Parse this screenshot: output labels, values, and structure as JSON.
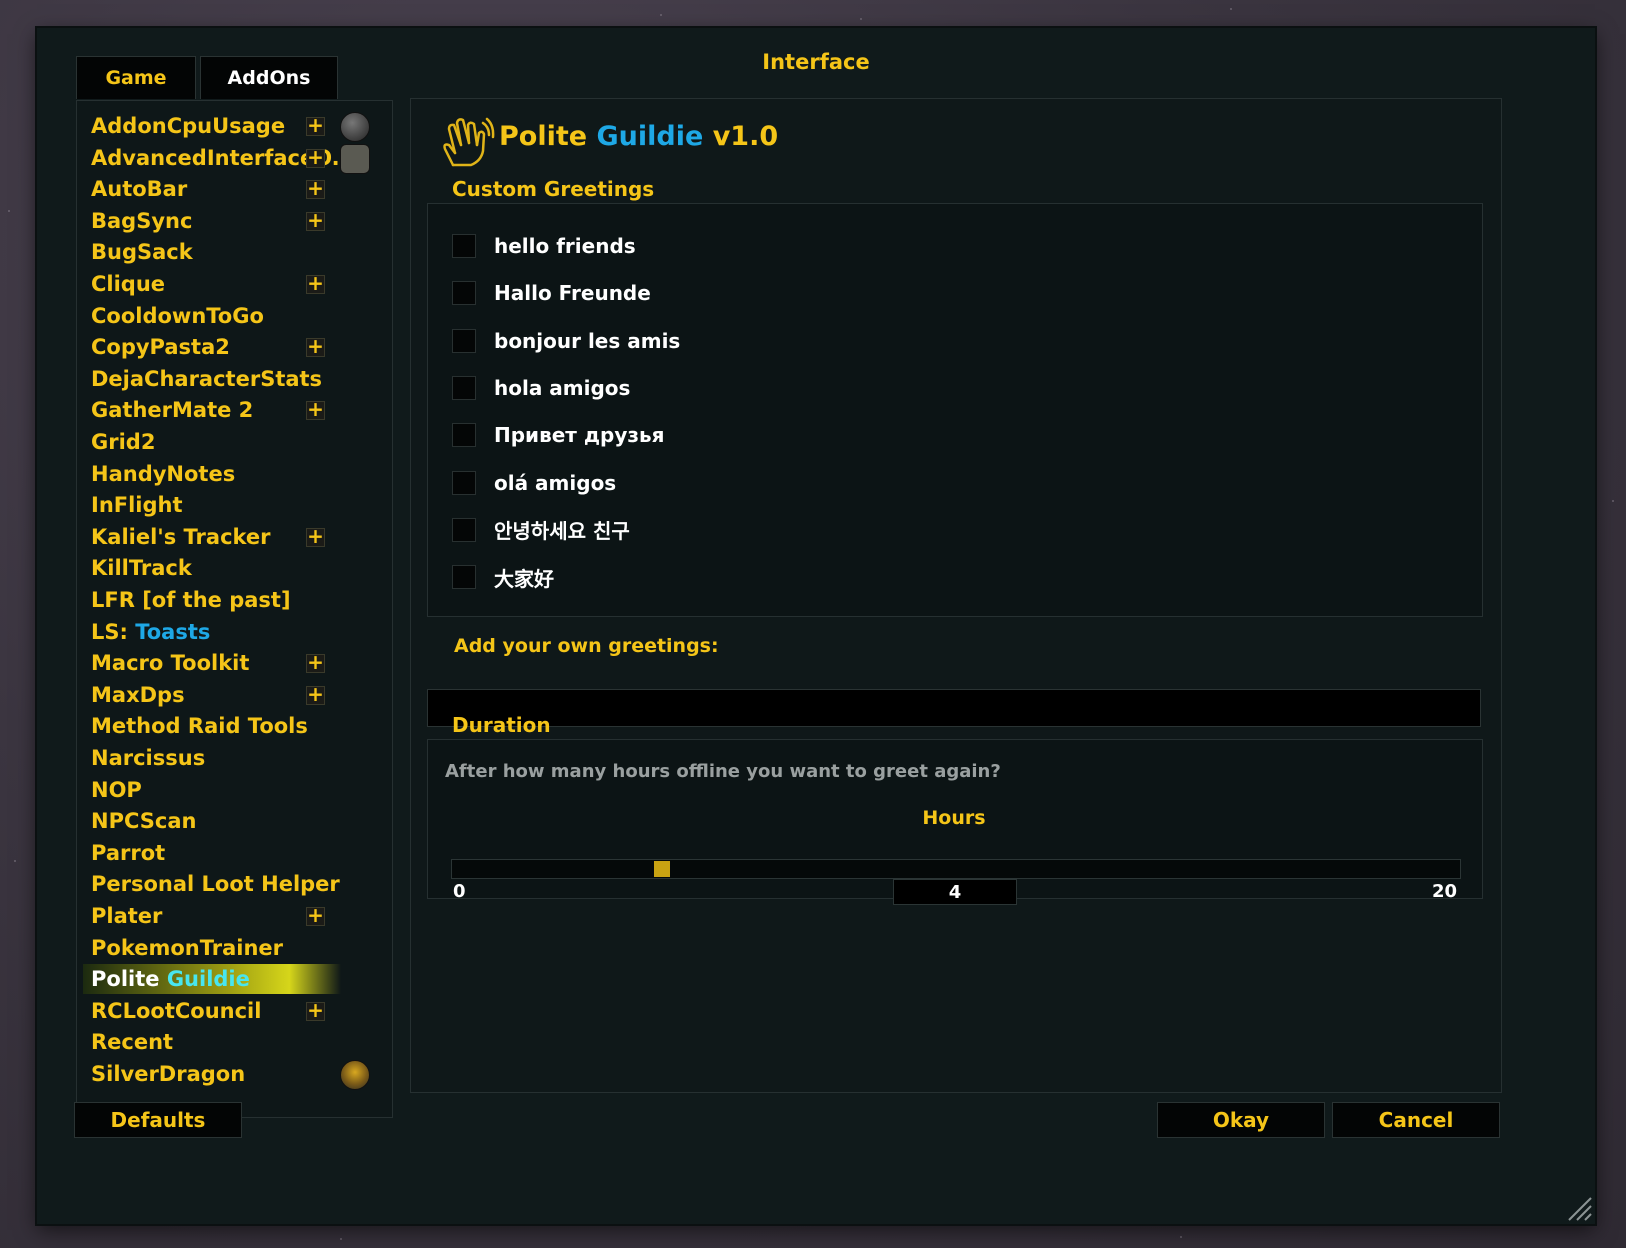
{
  "window": {
    "title": "Interface"
  },
  "tabs": [
    {
      "label": "Game",
      "active": true
    },
    {
      "label": "AddOns",
      "active": false
    }
  ],
  "addons": [
    {
      "name": "AddonCpuUsage",
      "expand": true,
      "icon": "settings-icon"
    },
    {
      "name": "AdvancedInterfaceO...",
      "expand": true,
      "icon": "square-stone-icon"
    },
    {
      "name": "AutoBar",
      "expand": true
    },
    {
      "name": "BagSync",
      "expand": true
    },
    {
      "name": "BugSack"
    },
    {
      "name": "Clique",
      "expand": true
    },
    {
      "name": "CooldownToGo"
    },
    {
      "name": "CopyPasta2",
      "expand": true
    },
    {
      "name": "DejaCharacterStats"
    },
    {
      "name": "GatherMate 2",
      "expand": true
    },
    {
      "name": "Grid2"
    },
    {
      "name": "HandyNotes"
    },
    {
      "name": "InFlight"
    },
    {
      "name": "Kaliel's Tracker",
      "expand": true
    },
    {
      "name": "KillTrack"
    },
    {
      "name": "LFR [of the past]"
    },
    {
      "name": "LS:",
      "name_highlight": "Toasts"
    },
    {
      "name": "Macro Toolkit",
      "expand": true
    },
    {
      "name": "MaxDps",
      "expand": true
    },
    {
      "name": "Method Raid Tools"
    },
    {
      "name": "Narcissus"
    },
    {
      "name": "NOP"
    },
    {
      "name": "NPCScan"
    },
    {
      "name": "Parrot"
    },
    {
      "name": "Personal Loot Helper"
    },
    {
      "name": "Plater",
      "expand": true
    },
    {
      "name": "PokemonTrainer"
    },
    {
      "name": "Polite",
      "name_highlight": "Guildie",
      "selected": true
    },
    {
      "name": "RCLootCouncil",
      "expand": true
    },
    {
      "name": "Recent"
    },
    {
      "name": "SilverDragon",
      "icon": "dragon-emblem-icon"
    }
  ],
  "panel": {
    "title_part1": "Polite",
    "title_part2": "Guildie",
    "title_part3": "v1.0",
    "icon": "waving-hand-icon",
    "custom_greetings_label": "Custom Greetings",
    "greetings": [
      {
        "text": "hello friends",
        "checked": false
      },
      {
        "text": "Hallo Freunde",
        "checked": false
      },
      {
        "text": "bonjour les amis",
        "checked": false
      },
      {
        "text": "hola amigos",
        "checked": false
      },
      {
        "text": "Привет друзья",
        "checked": false
      },
      {
        "text": "olá amigos",
        "checked": false
      },
      {
        "text": "안녕하세요 친구",
        "checked": false
      },
      {
        "text": "大家好",
        "checked": false
      }
    ],
    "add_own_label": "Add your own greetings:",
    "add_own_value": "",
    "duration_label": "Duration",
    "duration_question": "After how many hours offline you want to greet again?",
    "slider": {
      "label": "Hours",
      "min": "0",
      "max": "20",
      "value": "4",
      "min_num": 0,
      "max_num": 20,
      "value_num": 4
    }
  },
  "buttons": {
    "defaults": "Defaults",
    "okay": "Okay",
    "cancel": "Cancel"
  },
  "colors": {
    "accent": "#f5c518",
    "highlight_blue": "#1ea8e6",
    "background": "#101a1b"
  }
}
